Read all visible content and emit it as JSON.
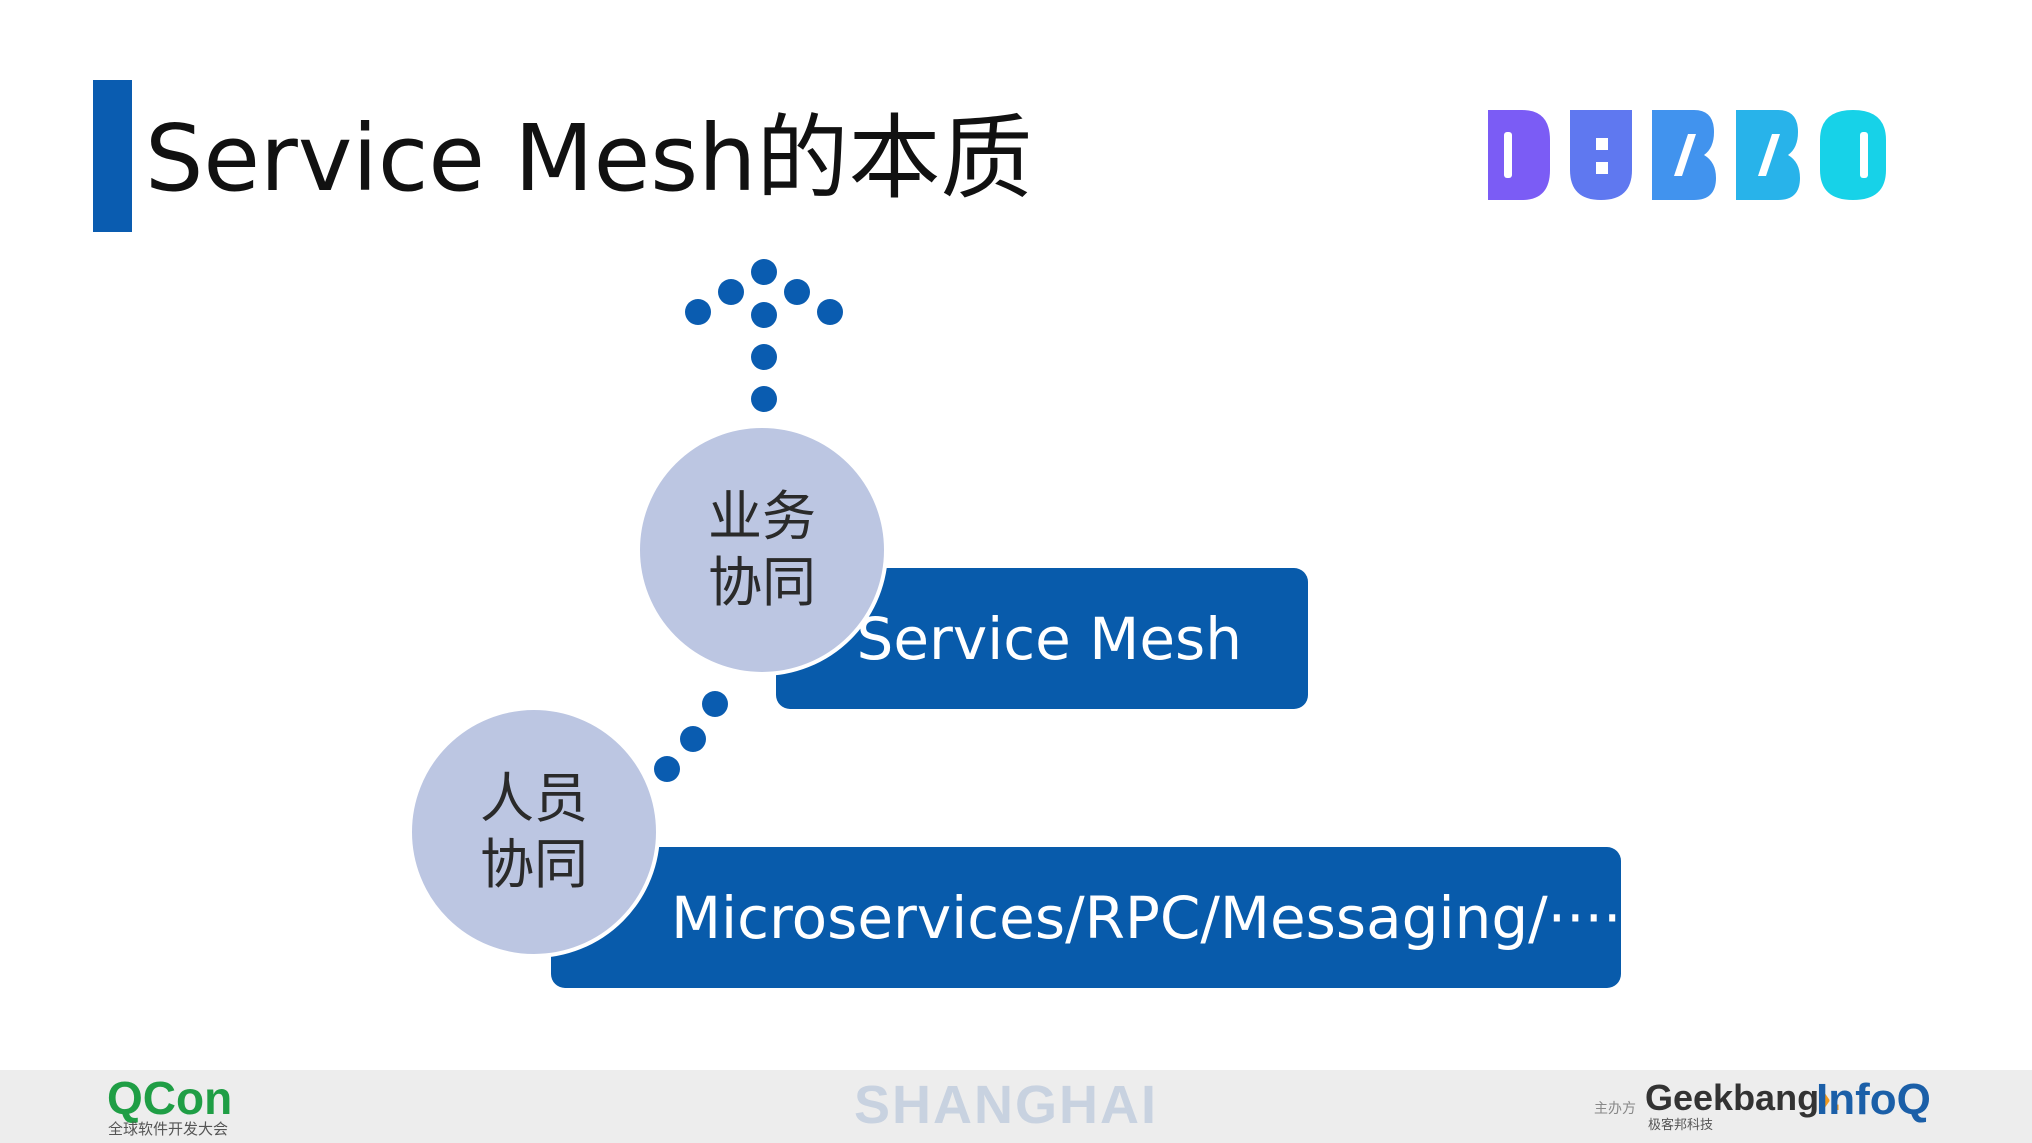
{
  "slide": {
    "title": "Service Mesh的本质"
  },
  "logo": {
    "text": "DUBBO",
    "colors": [
      "#7b5cf5",
      "#5c7ef0",
      "#3ea4ee",
      "#22c4e6",
      "#17d7e8"
    ]
  },
  "diagram": {
    "upper_bar_label": "Service Mesh",
    "lower_bar_label": "Microservices/RPC/Messaging/·····",
    "upper_circle_label": "业务\n协同",
    "lower_circle_label": "人员\n协同",
    "accent_color": "#085bab",
    "circle_color": "#bcc6e2",
    "arrow_icon": "dotted-up-arrow-icon"
  },
  "footer": {
    "brand": "QCon",
    "brand_sub": "全球软件开发大会",
    "city": "SHANGHAI",
    "organizer_label": "主办方",
    "sponsor1": "Geekbang",
    "sponsor1_sub": "极客邦科技",
    "sponsor2": "InfoQ"
  }
}
